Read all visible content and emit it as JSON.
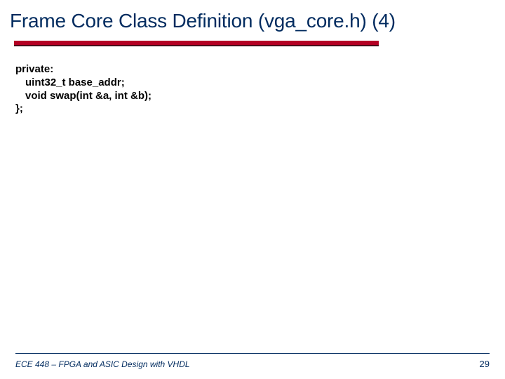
{
  "title": "Frame Core Class Definition (vga_core.h) (4)",
  "code": {
    "line1": "private:",
    "line2": "uint32_t base_addr;",
    "line3": "void swap(int &a, int &b);",
    "line4": "};"
  },
  "footer": "ECE 448 – FPGA and ASIC Design with VHDL",
  "page": "29"
}
